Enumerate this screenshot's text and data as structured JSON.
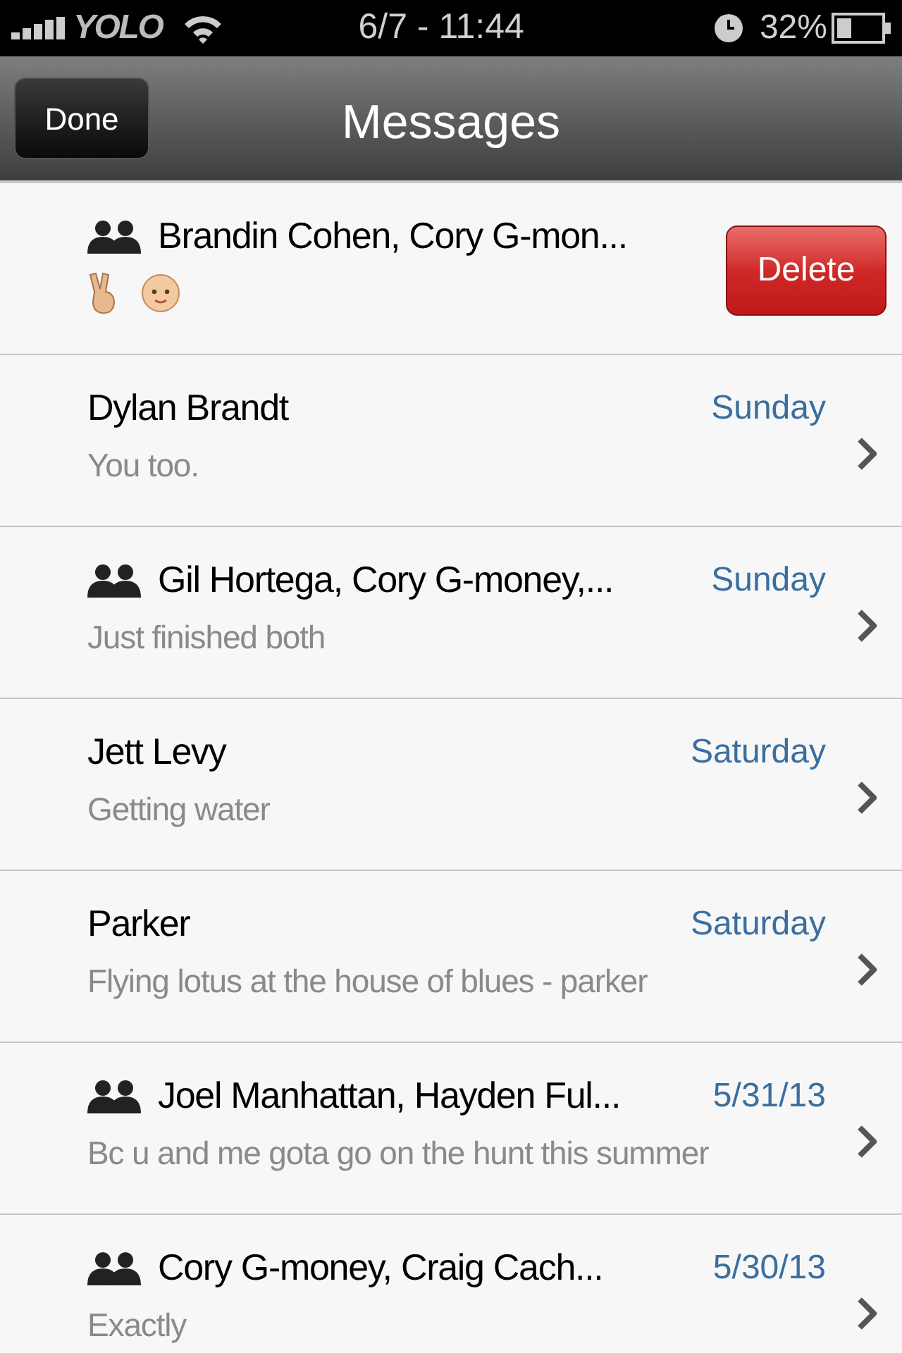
{
  "status_bar": {
    "carrier": "YOLO",
    "time": "6/7 - 11:44",
    "battery": "32%"
  },
  "nav_bar": {
    "done_button": "Done",
    "title": "Messages"
  },
  "conversations": [
    {
      "kind": "emoji",
      "group": true,
      "name": "Brandin Cohen, Cory G-mon...",
      "delete_button": "Delete"
    },
    {
      "group": false,
      "name": "Dylan Brandt",
      "date": "Sunday",
      "preview": "You too."
    },
    {
      "group": true,
      "name": "Gil Hortega, Cory G-money,...",
      "date": "Sunday",
      "preview": "Just finished both"
    },
    {
      "group": false,
      "name": "Jett Levy",
      "date": "Saturday",
      "preview": "Getting water"
    },
    {
      "group": false,
      "name": "Parker",
      "date": "Saturday",
      "preview": "Flying lotus at the house of blues - parker"
    },
    {
      "group": true,
      "name": "Joel Manhattan, Hayden Ful...",
      "date": "5/31/13",
      "preview": "Bc u and me gota go on the hunt this summer"
    },
    {
      "group": true,
      "name": "Cory G-money, Craig Cach...",
      "date": "5/30/13",
      "preview": "Exactly"
    }
  ]
}
